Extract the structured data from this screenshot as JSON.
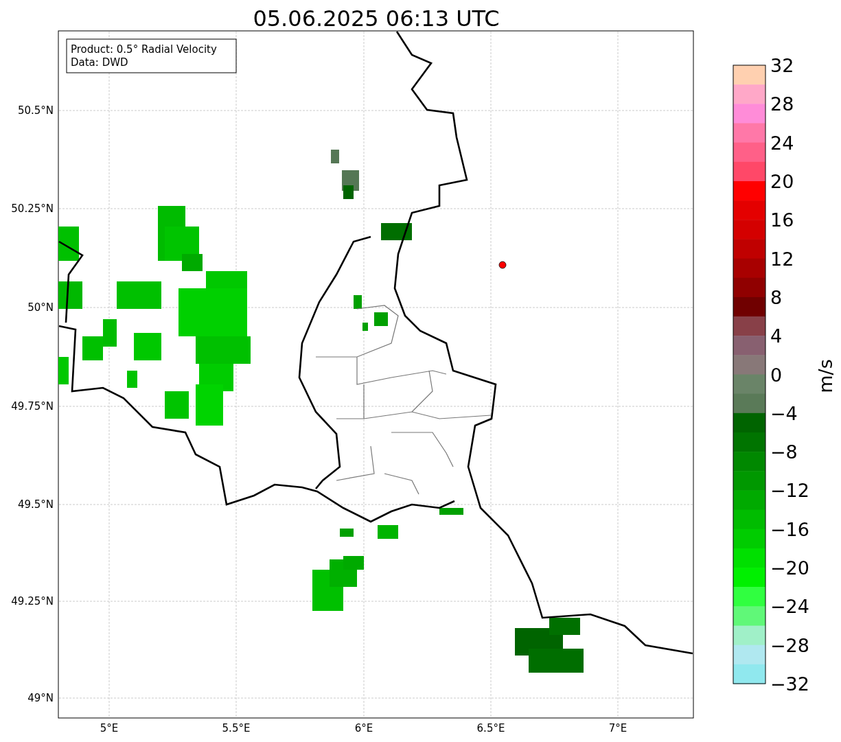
{
  "title": "05.06.2025 06:13 UTC",
  "info_box": [
    "Product: 0.5° Radial Velocity",
    "Data: DWD"
  ],
  "lat_labels": [
    "50.5°N",
    "50.25°N",
    "50°N",
    "49.75°N",
    "49.5°N",
    "49.25°N",
    "49°N"
  ],
  "lon_labels": [
    "5°E",
    "5.5°E",
    "6°E",
    "6.5°E",
    "7°E"
  ],
  "colorbar": {
    "ticks": [
      "32",
      "28",
      "24",
      "20",
      "16",
      "12",
      "8",
      "4",
      "0",
      "−4",
      "−8",
      "−12",
      "−16",
      "−20",
      "−24",
      "−28",
      "−32"
    ],
    "label": "m/s"
  }
}
